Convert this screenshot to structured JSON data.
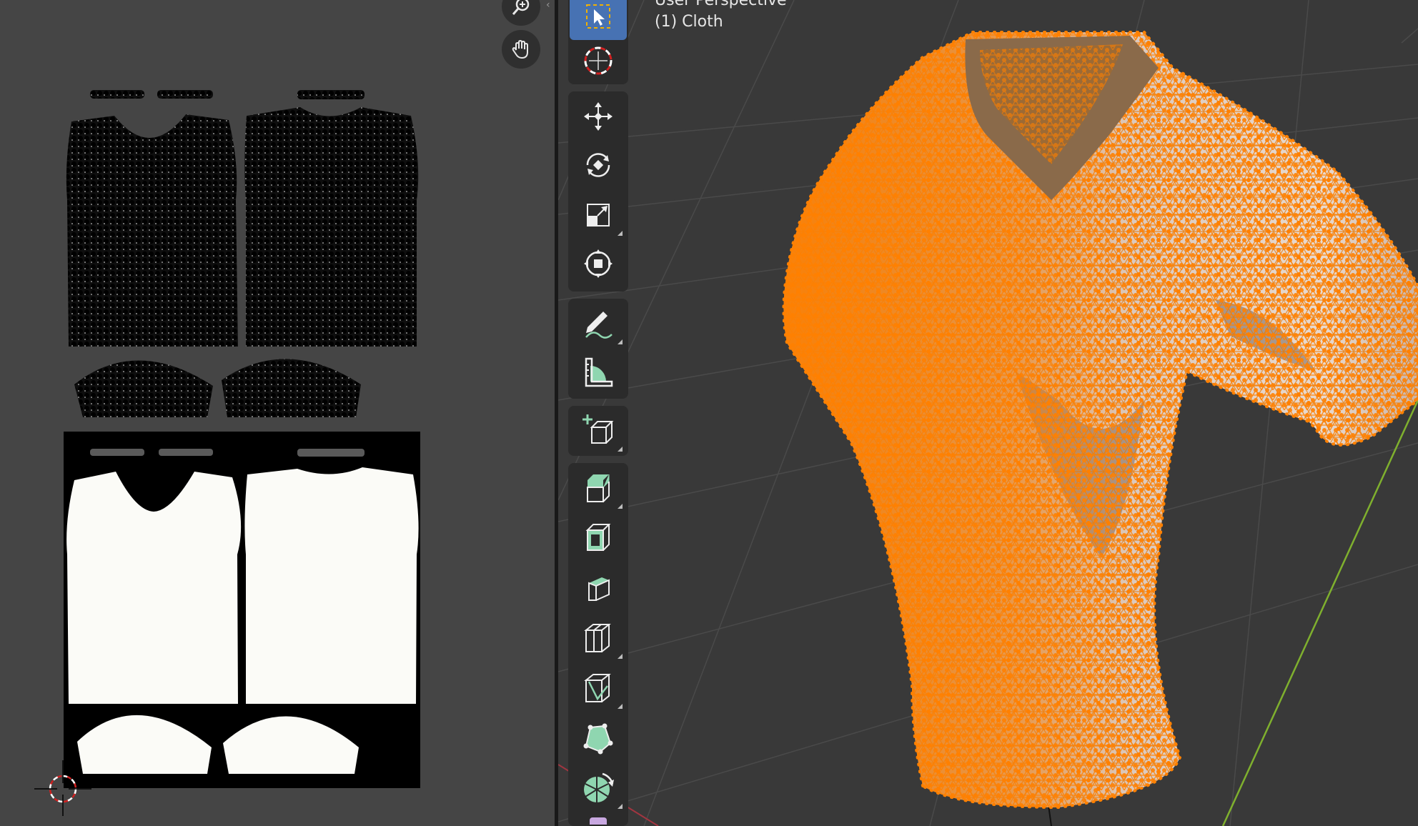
{
  "viewport": {
    "perspective_label": "User Perspective",
    "object_label": "(1) Cloth"
  },
  "uv_editor": {
    "nav_icons": [
      "zoom-icon",
      "hand-pan-icon"
    ]
  },
  "toolbar": {
    "tools": [
      {
        "name": "select-box",
        "icon": "select-box-icon",
        "active": true
      },
      {
        "name": "cursor",
        "icon": "cursor-icon",
        "active": false
      },
      {
        "name": "move",
        "icon": "move-icon",
        "active": false
      },
      {
        "name": "rotate",
        "icon": "rotate-icon",
        "active": false
      },
      {
        "name": "scale",
        "icon": "scale-icon",
        "active": false
      },
      {
        "name": "transform",
        "icon": "transform-icon",
        "active": false
      },
      {
        "name": "annotate",
        "icon": "annotate-icon",
        "active": false
      },
      {
        "name": "measure",
        "icon": "measure-icon",
        "active": false
      },
      {
        "name": "add-cube",
        "icon": "add-cube-icon",
        "active": false
      },
      {
        "name": "extrude",
        "icon": "extrude-icon",
        "active": false
      },
      {
        "name": "inset",
        "icon": "inset-icon",
        "active": false
      },
      {
        "name": "bevel",
        "icon": "bevel-icon",
        "active": false
      },
      {
        "name": "loop-cut",
        "icon": "loop-cut-icon",
        "active": false
      },
      {
        "name": "knife",
        "icon": "knife-icon",
        "active": false
      },
      {
        "name": "poly-build",
        "icon": "poly-build-icon",
        "active": false
      },
      {
        "name": "spin",
        "icon": "spin-icon",
        "active": false
      }
    ]
  },
  "colors": {
    "selection": "#ff8000",
    "active_tool": "#4772b3",
    "tool_accent": "#8fd6b0",
    "y_axis": "#7fb02e",
    "x_axis": "#a23540"
  }
}
